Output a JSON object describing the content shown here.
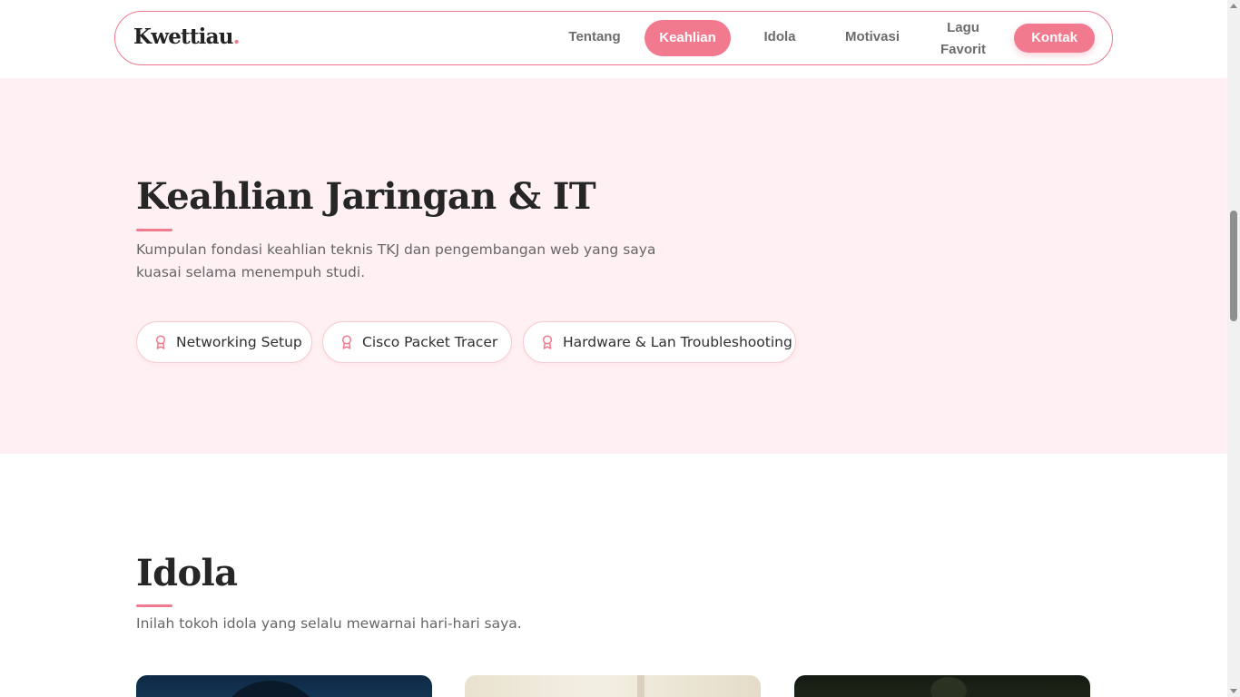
{
  "brand": {
    "name": "Kwettiau",
    "dot": "."
  },
  "nav": {
    "items": [
      {
        "label": "Tentang"
      },
      {
        "label": "Keahlian",
        "active": true
      },
      {
        "label": "Idola"
      },
      {
        "label": "Motivasi"
      },
      {
        "label_line1": "Lagu",
        "label_line2": "Favorit"
      }
    ],
    "cta": "Kontak"
  },
  "skills": {
    "title": "Keahlian Jaringan & IT",
    "description_line1": "Kumpulan fondasi keahlian teknis TKJ dan pengembangan web yang saya",
    "description_line2": "kuasai selama menempuh studi.",
    "items": [
      {
        "label": "Networking Setup",
        "icon": "award-icon"
      },
      {
        "label": "Cisco Packet Tracer",
        "icon": "award-icon"
      },
      {
        "label": "Hardware & Lan Troubleshooting",
        "icon": "award-icon"
      }
    ]
  },
  "idola": {
    "title": "Idola",
    "description": "Inilah tokoh idola yang selalu mewarnai hari-hari saya."
  },
  "colors": {
    "accent": "#f27a8e",
    "section_bg": "#fff1f3",
    "text_dark": "#262626",
    "text_muted": "#666666"
  }
}
